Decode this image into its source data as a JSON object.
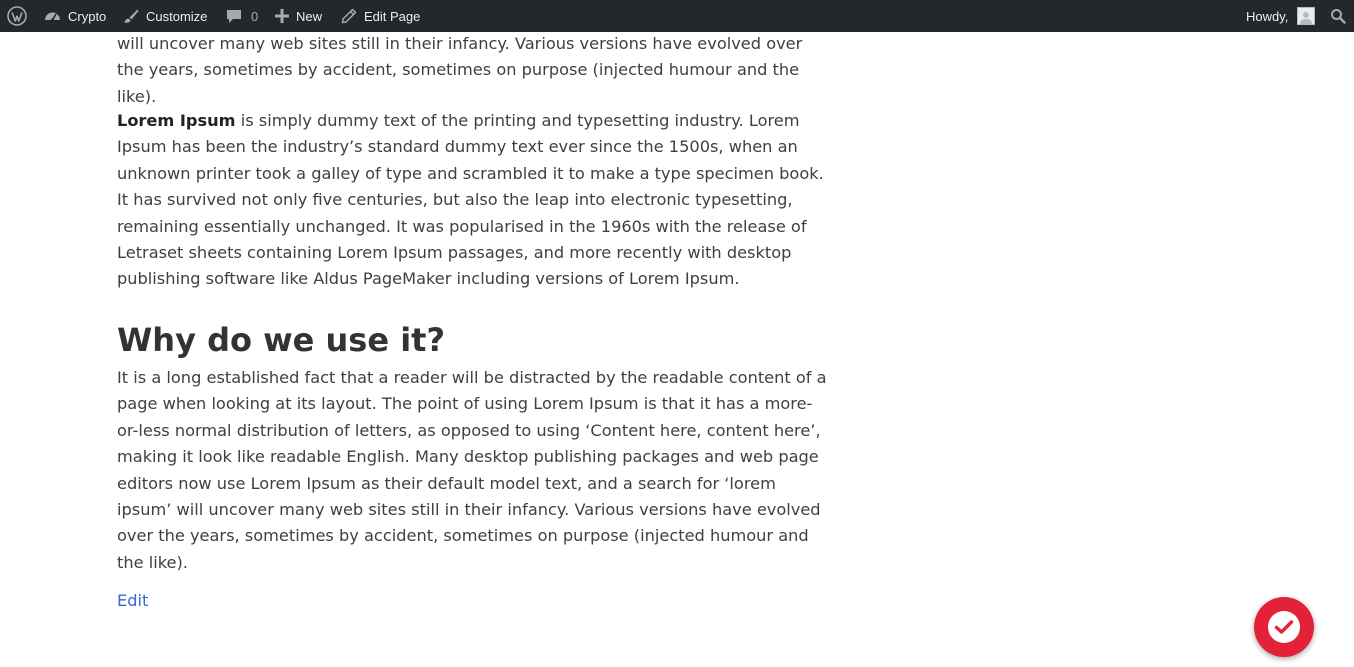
{
  "admin_bar": {
    "site_name": "Crypto",
    "customize_label": "Customize",
    "comments_count": "0",
    "new_label": "New",
    "edit_page_label": "Edit Page",
    "howdy_label": "Howdy,"
  },
  "content": {
    "top_paragraph": "will uncover many web sites still in their infancy. Various versions have evolved over the years, sometimes by accident, sometimes on purpose (injected humour and the like).",
    "intro_strong": "Lorem Ipsum",
    "intro_rest": " is simply dummy text of the printing and typesetting industry. Lorem Ipsum has been the industry’s standard dummy text ever since the 1500s, when an unknown printer took a galley of type and scrambled it to make a type specimen book. It has survived not only five centuries, but also the leap into electronic typesetting, remaining essentially unchanged. It was popularised in the 1960s with the release of Letraset sheets containing Lorem Ipsum passages, and more recently with desktop publishing software like Aldus PageMaker including versions of Lorem Ipsum.",
    "heading": "Why do we use it?",
    "why_paragraph": "It is a long established fact that a reader will be distracted by the readable content of a page when looking at its layout. The point of using Lorem Ipsum is that it has a more-or-less normal distribution of letters, as opposed to using ‘Content here, content here’, making it look like readable English. Many desktop publishing packages and web page editors now use Lorem Ipsum as their default model text, and a search for ‘lorem ipsum’ will uncover many web sites still in their infancy. Various versions have evolved over the years, sometimes by accident, sometimes on purpose (injected humour and the like).",
    "edit_link": "Edit"
  },
  "colors": {
    "admin_bar_bg": "#23282d",
    "link": "#3a66d6",
    "fab": "#e32239"
  },
  "icons": {
    "wp_logo": "wordpress-logo-icon",
    "site": "dashboard-gauge-icon",
    "customize": "paintbrush-icon",
    "comments": "comment-bubble-icon",
    "new": "plus-icon",
    "edit": "pencil-icon",
    "avatar": "user-avatar-icon",
    "search": "search-icon",
    "fab": "checkmark-circle-icon"
  }
}
